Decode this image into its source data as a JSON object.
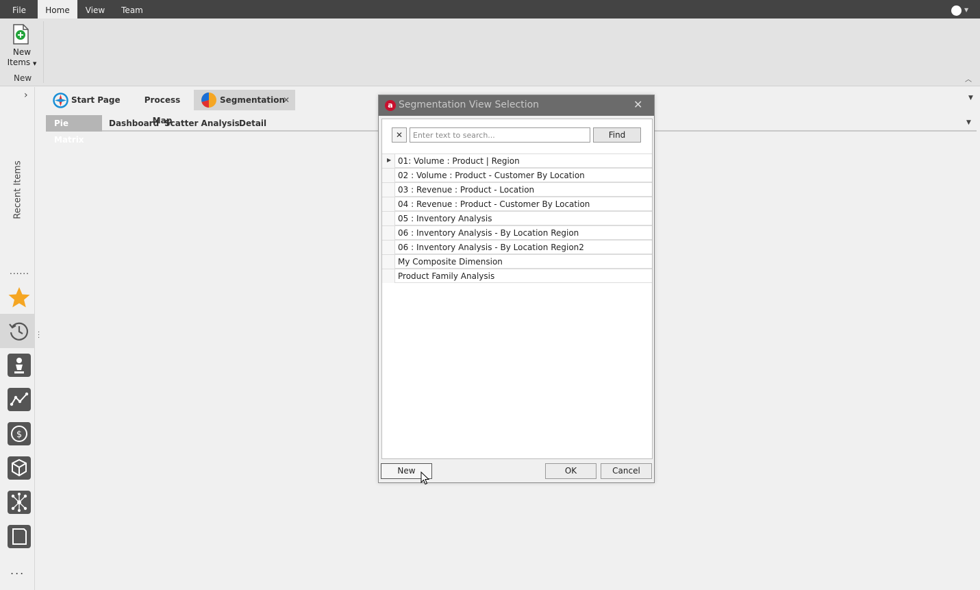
{
  "menubar": {
    "items": [
      {
        "label": "File",
        "active": false
      },
      {
        "label": "Home",
        "active": true
      },
      {
        "label": "View",
        "active": false
      },
      {
        "label": "Team",
        "active": false
      }
    ]
  },
  "ribbon": {
    "new_items_line1": "New",
    "new_items_line2": "Items",
    "group_label": "New"
  },
  "sidebar": {
    "recent_items_label": "Recent Items",
    "dots": "......",
    "more": "..."
  },
  "doc_tabs": [
    {
      "label": "Start Page",
      "active": false
    },
    {
      "label": "Process Map",
      "active": false
    },
    {
      "label": "Segmentation",
      "active": true
    }
  ],
  "sub_tabs": [
    {
      "label": "Pie Matrix",
      "active": true
    },
    {
      "label": "Dashboard",
      "active": false
    },
    {
      "label": "Scatter Analysis",
      "active": false
    },
    {
      "label": "Detail",
      "active": false
    }
  ],
  "dialog": {
    "title": "Segmentation View Selection",
    "search_placeholder": "Enter text to search...",
    "find_label": "Find",
    "rows": [
      "01: Volume : Product  |  Region",
      "02 : Volume : Product - Customer By Location",
      "03 : Revenue : Product - Location",
      "04 : Revenue : Product - Customer By Location",
      "05 : Inventory Analysis",
      "06 : Inventory Analysis - By Location Region",
      "06 : Inventory Analysis - By Location Region2",
      "My Composite Dimension",
      "Product Family Analysis"
    ],
    "new_label": "New",
    "ok_label": "OK",
    "cancel_label": "Cancel"
  },
  "colors": {
    "menubar_bg": "#444444",
    "accent_star": "#f5a623",
    "logo_red": "#c8102e",
    "dialog_title_bg": "#6b6b6b"
  }
}
